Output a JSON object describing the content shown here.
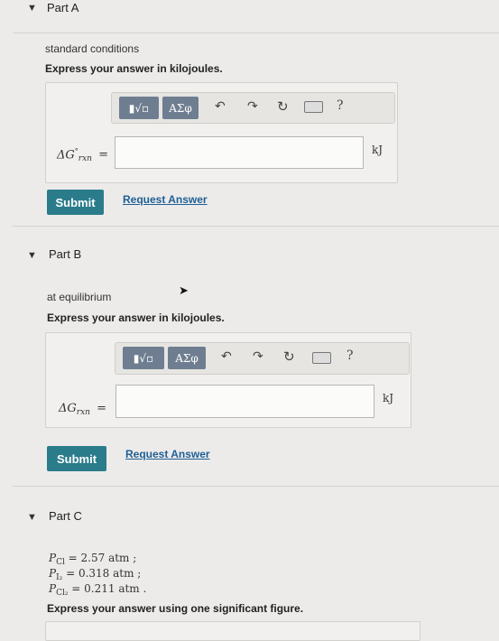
{
  "partA": {
    "caret": "▼",
    "title": "Part A",
    "condition": "standard conditions",
    "instruction": "Express your answer in kilojoules.",
    "var_main": "ΔG",
    "var_sup": "°",
    "var_sub": "rxn",
    "equals": "=",
    "unit": "kJ",
    "submit_label": "Submit",
    "request_label": "Request Answer"
  },
  "partB": {
    "caret": "▼",
    "title": "Part B",
    "condition": "at equilibrium",
    "instruction": "Express your answer in kilojoules.",
    "var_main": "ΔG",
    "var_sub": "rxn",
    "equals": "=",
    "unit": "kJ",
    "submit_label": "Submit",
    "request_label": "Request Answer"
  },
  "partC": {
    "caret": "▼",
    "title": "Part C",
    "conditions": [
      {
        "var": "P",
        "sub": "Cl",
        "eq": "= 2.57 atm ;"
      },
      {
        "var": "P",
        "sub": "I₂",
        "eq": "= 0.318 atm ;"
      },
      {
        "var": "P",
        "sub": "Cl₂",
        "eq": "= 0.211 atm ."
      }
    ],
    "instruction": "Express your answer using one significant figure."
  },
  "toolbar": {
    "templates_label": "▮√▫",
    "symbols_label": "ΑΣφ",
    "undo_icon": "undo",
    "redo_icon": "redo",
    "reset_icon": "reset",
    "keyboard_icon": "keyboard",
    "help_label": "?"
  }
}
